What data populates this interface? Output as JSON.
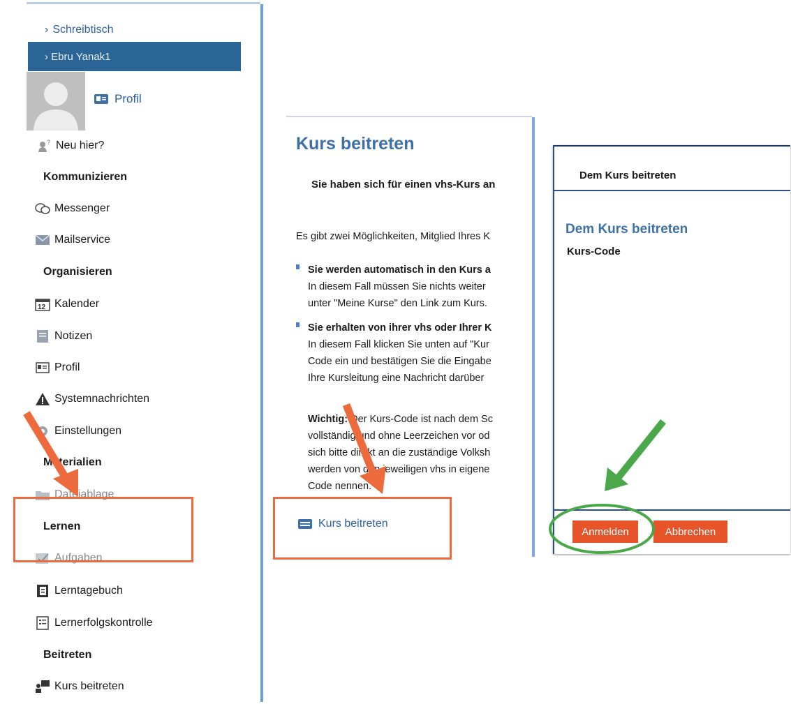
{
  "sidebar": {
    "desk_link": "Schreibtisch",
    "user_name": "Ebru Yanak1",
    "profile_link": "Profil",
    "new_here": "Neu hier?",
    "sections": {
      "communicate": "Kommunizieren",
      "organize": "Organisieren",
      "materials": "Materialien",
      "learn": "Lernen",
      "join": "Beitreten"
    },
    "items": {
      "messenger": "Messenger",
      "mailservice": "Mailservice",
      "calendar": "Kalender",
      "calendar_icon_day": "12",
      "notes": "Notizen",
      "profile": "Profil",
      "system_messages": "Systemnachrichten",
      "settings": "Einstellungen",
      "file_storage": "Dateiablage",
      "tasks": "Aufgaben",
      "learning_diary": "Lerntagebuch",
      "progress_check": "Lernerfolgskontrolle",
      "join_course": "Kurs beitreten"
    }
  },
  "middle": {
    "title": "Kurs beitreten",
    "subtitle": "Sie haben sich für einen vhs-Kurs an",
    "intro": "Es gibt zwei Möglichkeiten, Mitglied Ihres K",
    "option1_title": "Sie werden automatisch in den Kurs a",
    "option1_line1": "In diesem Fall müssen Sie nichts weiter",
    "option1_line2": "unter \"Meine Kurse\" den Link zum Kurs.",
    "option2_title": "Sie erhalten von ihrer vhs oder Ihrer K",
    "option2_line1": "In diesem Fall klicken Sie unten auf \"Kur",
    "option2_line2": "Code ein und bestätigen Sie die Eingabe",
    "option2_line3": "Ihre Kursleitung eine Nachricht darüber",
    "important_label": "Wichtig:",
    "important_line1": "Der Kurs-Code ist nach dem Sc",
    "important_line2": "vollständig und ohne Leerzeichen vor od",
    "important_line3": "sich bitte direkt an die zuständige Volksh",
    "important_line4": "werden von den jeweiligen vhs in eigene",
    "important_line5": "Code nennen.",
    "join_link": "Kurs beitreten"
  },
  "dialog": {
    "header": "Dem Kurs beitreten",
    "title": "Dem Kurs beitreten",
    "field_label": "Kurs-Code",
    "login_button": "Anmelden",
    "cancel_button": "Abbrechen"
  },
  "colors": {
    "accent_blue": "#3e70a8",
    "user_bar": "#2a6595",
    "button_orange": "#e8542a",
    "annotation_orange": "#ec6a3c",
    "annotation_green": "#4aa84a"
  }
}
